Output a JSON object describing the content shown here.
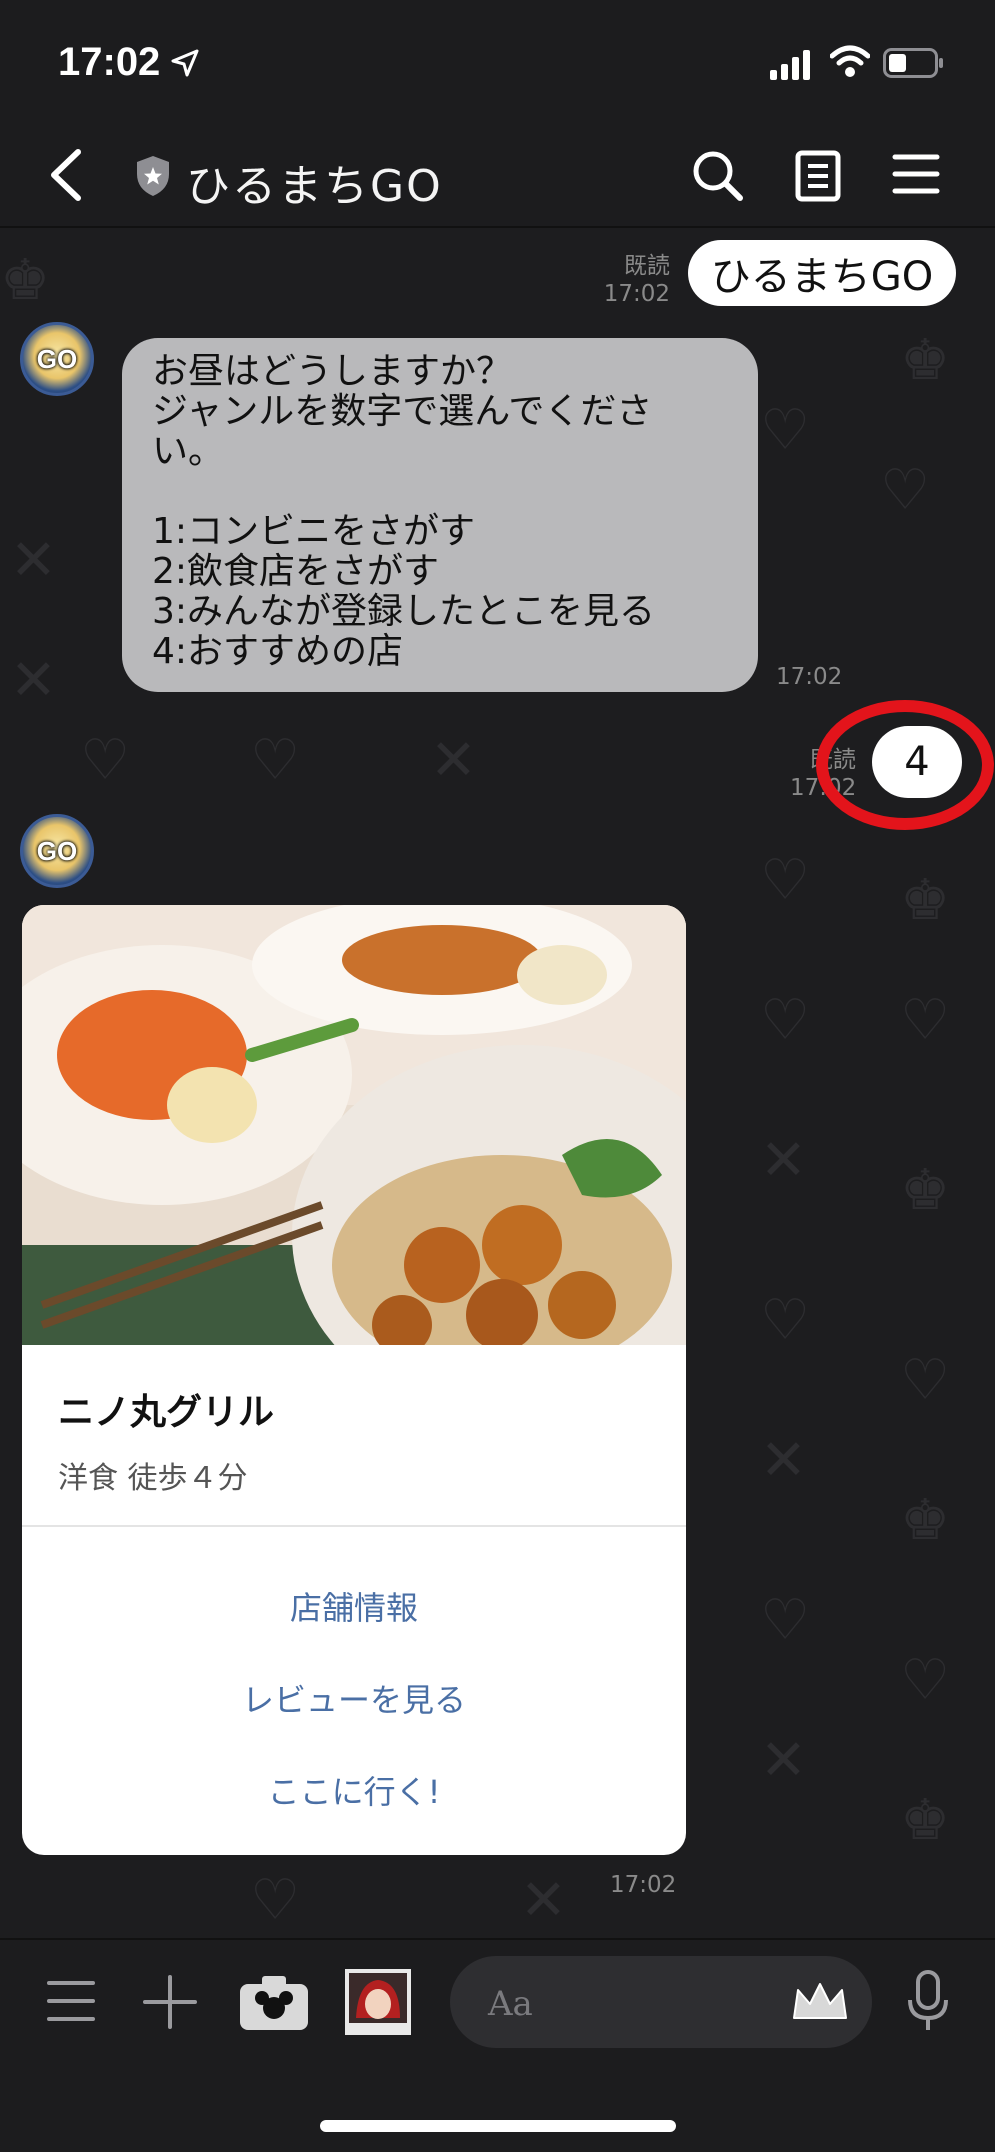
{
  "status_bar": {
    "time": "17:02"
  },
  "header": {
    "title": "ひるまちGO"
  },
  "messages": {
    "user_msg_1": {
      "text": "ひるまちGO",
      "read": "既読",
      "time": "17:02"
    },
    "bot_msg_1": {
      "lines": [
        "お昼はどうしますか？",
        "ジャンルを数字で選んでくださ",
        "い。",
        "",
        "1:コンビニをさがす",
        "2:飲食店をさがす",
        "3:みんなが登録したとこを見る",
        "4:おすすめの店"
      ],
      "time": "17:02"
    },
    "user_msg_2": {
      "text": "4",
      "read": "既読",
      "time": "17:02"
    },
    "bot_avatar_text": "GO"
  },
  "card": {
    "title": "ニノ丸グリル",
    "subtitle": "洋食 徒歩４分",
    "actions": [
      "店舗情報",
      "レビューを見る",
      "ここに行く!"
    ],
    "time": "17:02"
  },
  "input": {
    "placeholder": "Aa"
  },
  "colors": {
    "accent": "#4a6fa5",
    "annotation": "#e3141b",
    "bot_bubble": "#b9b9bb"
  }
}
